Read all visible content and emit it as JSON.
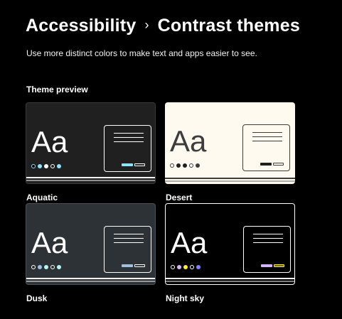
{
  "header": {
    "breadcrumb_parent": "Accessibility",
    "separator": "›",
    "page_title": "Contrast themes",
    "subtitle": "Use more distinct colors to make text and apps easier to see."
  },
  "section_label": "Theme preview",
  "themes": [
    {
      "name": "Aquatic",
      "sample_text": "Aa",
      "background": "#202020",
      "text_color": "#ffffff",
      "accent": "#8ee3f7",
      "dot_colors": [
        "#000000",
        "#8ee3f7",
        "#ffffff",
        "#000000",
        "#8ee3f7"
      ]
    },
    {
      "name": "Desert",
      "sample_text": "Aa",
      "background": "#fffaef",
      "text_color": "#3d3d3d",
      "accent": "#202020",
      "dot_colors": [
        "#fffaef",
        "#202020",
        "#202020",
        "#fffaef",
        "#3d3d3d"
      ]
    },
    {
      "name": "Dusk",
      "sample_text": "Aa",
      "background": "#2d3236",
      "text_color": "#ffffff",
      "accent": "#a1bfde",
      "dot_colors": [
        "#2d3236",
        "#a1bfde",
        "#b6f6f0",
        "#2d3236",
        "#b6f6f0"
      ]
    },
    {
      "name": "Night sky",
      "sample_text": "Aa",
      "background": "#000000",
      "text_color": "#ffffff",
      "accent": "#d6b4fd",
      "dot_colors": [
        "#000000",
        "#d6b4fd",
        "#ffee32",
        "#000000",
        "#8080ff"
      ]
    }
  ]
}
